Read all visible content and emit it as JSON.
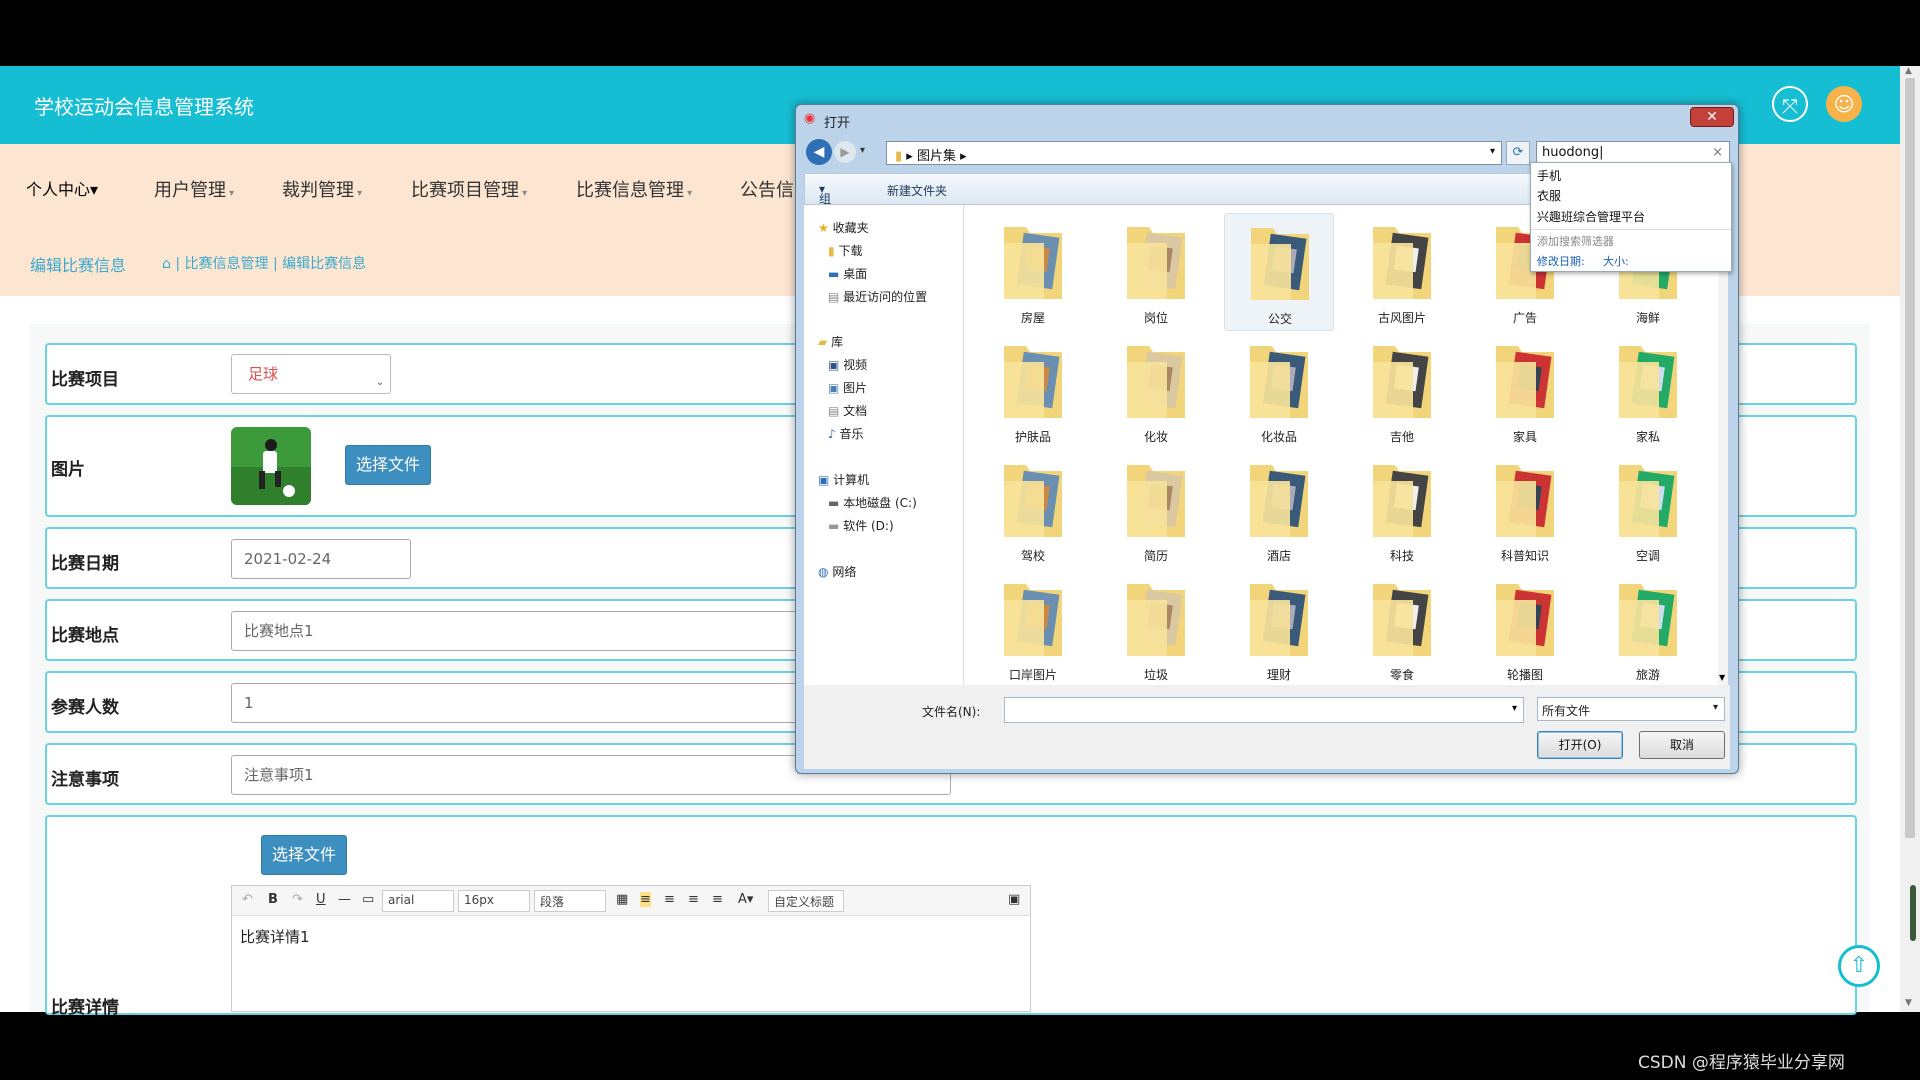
{
  "header": {
    "title": "学校运动会信息管理系统"
  },
  "nav": {
    "items": [
      "个人中心",
      "用户管理",
      "裁判管理",
      "比赛项目管理",
      "比赛信息管理",
      "公告信"
    ]
  },
  "breadcrumb": {
    "current": "编辑比赛信息",
    "path": "| 比赛信息管理 | 编辑比赛信息"
  },
  "form": {
    "project_label": "比赛项目",
    "project_value": "足球",
    "image_label": "图片",
    "choose_file": "选择文件",
    "date_label": "比赛日期",
    "date_value": "2021-02-24",
    "place_label": "比赛地点",
    "place_value": "比赛地点1",
    "count_label": "参赛人数",
    "count_value": "1",
    "notes_label": "注意事项",
    "notes_value": "注意事项1",
    "details_label": "比赛详情",
    "details_value": "比赛详情1"
  },
  "editor": {
    "font": "arial",
    "size": "16px",
    "paragraph": "段落",
    "custom_title": "自定义标题"
  },
  "dialog": {
    "title": "打开",
    "path": "图片集",
    "search_value": "huodong",
    "organize": "组织",
    "new_folder": "新建文件夹",
    "nav": {
      "favorites": "收藏夹",
      "downloads": "下载",
      "desktop": "桌面",
      "recent": "最近访问的位置",
      "library": "库",
      "videos": "视频",
      "pictures": "图片",
      "documents": "文档",
      "music": "音乐",
      "computer": "计算机",
      "drive_c": "本地磁盘 (C:)",
      "drive_d": "软件 (D:)",
      "network": "网络"
    },
    "folders": [
      "房屋",
      "岗位",
      "公交",
      "古风图片",
      "广告",
      "海鲜",
      "护肤品",
      "化妆",
      "化妆品",
      "吉他",
      "家具",
      "家私",
      "驾校",
      "简历",
      "酒店",
      "科技",
      "科普知识",
      "空调",
      "口岸图片",
      "垃圾",
      "理财",
      "零食",
      "轮播图",
      "旅游"
    ],
    "filename_label": "文件名(N):",
    "filetype": "所有文件",
    "open_button": "打开(O)",
    "cancel_button": "取消",
    "suggestions": [
      "手机",
      "衣服",
      "兴趣班综合管理平台"
    ],
    "add_filter": "添加搜索筛选器",
    "filter_date": "修改日期:",
    "filter_size": "大小:"
  },
  "watermark": "CSDN @程序猿毕业分享网"
}
